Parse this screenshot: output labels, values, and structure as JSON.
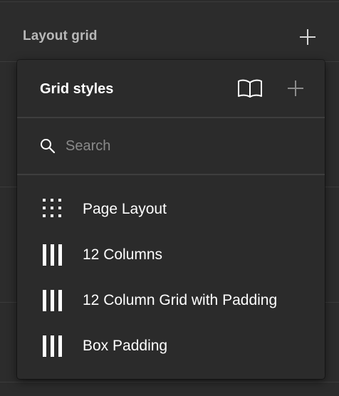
{
  "panel": {
    "title": "Layout grid",
    "add_icon": "plus-icon"
  },
  "popup": {
    "title": "Grid styles",
    "library_icon": "book-icon",
    "add_icon": "plus-icon",
    "search": {
      "placeholder": "Search",
      "value": "",
      "icon": "search-icon"
    },
    "items": [
      {
        "label": "Page Layout",
        "icon": "grid-dots-icon"
      },
      {
        "label": "12 Columns",
        "icon": "columns-icon"
      },
      {
        "label": "12 Column Grid with Padding",
        "icon": "columns-icon"
      },
      {
        "label": "Box Padding",
        "icon": "columns-icon"
      }
    ]
  },
  "colors": {
    "panel_bg": "#2c2c2c",
    "popup_bg": "#2b2b2b",
    "text_primary": "#ffffff",
    "text_muted": "#b8b8b8",
    "placeholder": "#8a8a8a"
  }
}
